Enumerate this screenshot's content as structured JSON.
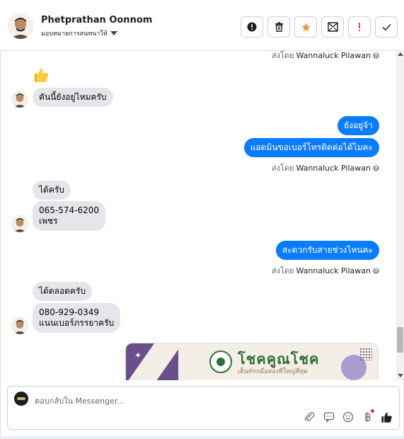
{
  "header": {
    "name": "Phetprathan Oonnom",
    "assign_label": "มอบหมายการสนทนาให้",
    "actions": [
      "alert-circle-icon",
      "trash-icon",
      "star-icon",
      "mark-unread-icon",
      "spam-icon",
      "check-icon"
    ],
    "star_color": "#f7923a",
    "spam_color": "#e4405f"
  },
  "conversation": {
    "sent_by_label": "ส่งโดย",
    "agent_name": "Wannaluck Pilawan",
    "messages": [
      {
        "dir": "in",
        "text": "คันนี้ยังอยู่ไหมครับ"
      },
      {
        "dir": "out",
        "text": "ยังอยู่จ้า"
      },
      {
        "dir": "out",
        "text": "แอดมินขอเบอร์โทรติดต่อได้ไมคะ"
      },
      {
        "dir": "in",
        "text": "ได้ครับ"
      },
      {
        "dir": "in",
        "line1": "065-574-6200",
        "line2": "เพชร"
      },
      {
        "dir": "out",
        "text": "สะดวกรับสายช่วงไหนคะ"
      },
      {
        "dir": "in",
        "text": "ได้ตลอดครับ"
      },
      {
        "dir": "in",
        "line1": "080-929-0349",
        "line2": "แนนเบอร์ภรรยาครับ"
      }
    ],
    "image_card": {
      "brand": "โชคคูณโชค",
      "tagline": "เต็นท์รถมือสองที่ใหญ่ที่สุด"
    },
    "bubble_out_color": "#0a7cff",
    "bubble_in_color": "#e4e6eb"
  },
  "reply": {
    "placeholder": "ตอบกลับใน Messenger..."
  }
}
